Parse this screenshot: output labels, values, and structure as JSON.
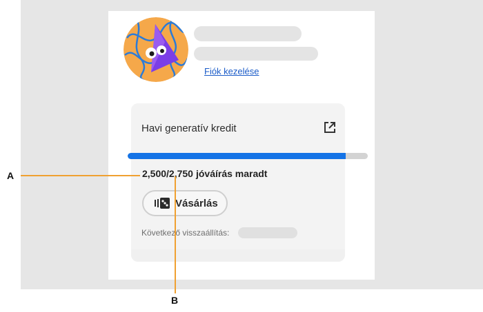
{
  "account": {
    "manage_link": "Fiók kezelése"
  },
  "credits": {
    "title": "Havi generatív kredit",
    "used_text": "2,500/2,750",
    "remaining_label": "jóváírás maradt",
    "remaining": 2500,
    "total": 2750,
    "buy_button_label": "Vásárlás",
    "next_reset_label": "Következő visszaállítás:"
  },
  "callouts": {
    "a": "A",
    "b": "B"
  },
  "colors": {
    "accent": "#1473e6",
    "link": "#1a5bc8",
    "callout": "#f0a030"
  },
  "icons": {
    "avatar": "avatar-illustration",
    "external": "open-external-icon",
    "buy": "credits-icon"
  }
}
